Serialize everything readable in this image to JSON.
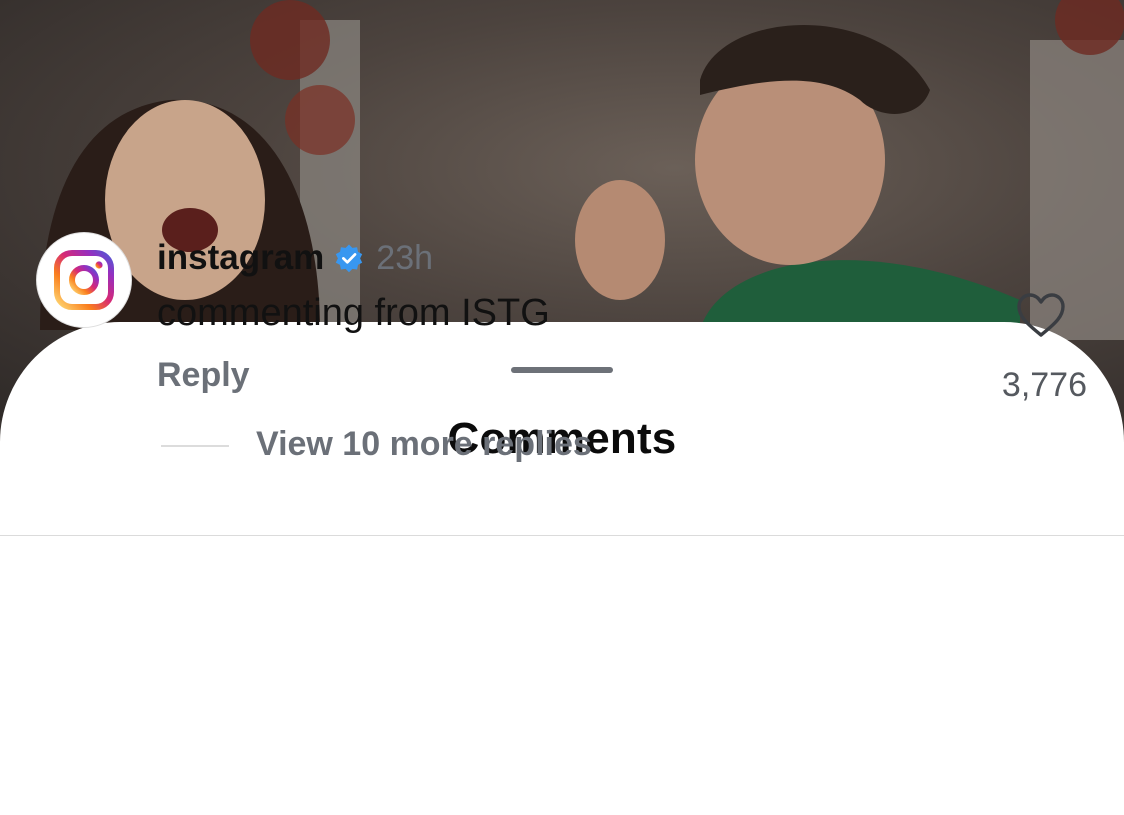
{
  "sheet": {
    "title": "Comments"
  },
  "comment": {
    "username": "instagram",
    "verified": true,
    "timestamp": "23h",
    "text": "commenting from ISTG",
    "reply_label": "Reply",
    "like_count": "3,776",
    "view_replies_label": "View 10 more replies",
    "avatar_icon": "instagram-logo-icon",
    "verified_icon": "verified-badge-icon",
    "like_icon": "heart-icon"
  },
  "colors": {
    "verified_blue": "#3897f0",
    "secondary_text": "#6b7078",
    "handle": "#6d7178"
  }
}
